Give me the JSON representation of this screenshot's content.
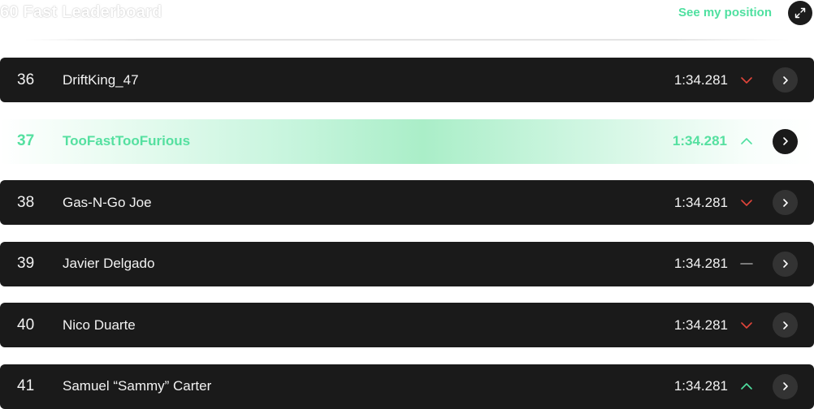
{
  "header": {
    "title": "60 Fast Leaderboard",
    "see_position_label": "See my position"
  },
  "colors": {
    "accent": "#4fe0a0",
    "down": "#e0453a",
    "up": "#4fe0a0",
    "neutral": "#9a9a9a",
    "row_bg": "#1a1a1a"
  },
  "rows": [
    {
      "rank": "36",
      "driver": "DriftKing_47",
      "time": "1:34.281",
      "trend": "down",
      "trend_icon": "chevron-down-icon"
    },
    {
      "rank": "37",
      "driver": "TooFastTooFurious",
      "time": "1:34.281",
      "trend": "up",
      "trend_icon": "chevron-up-icon",
      "current_user": true
    },
    {
      "rank": "38",
      "driver": "Gas-N-Go Joe",
      "time": "1:34.281",
      "trend": "down",
      "trend_icon": "chevron-down-icon"
    },
    {
      "rank": "39",
      "driver": "Javier Delgado",
      "time": "1:34.281",
      "trend": "same",
      "trend_icon": "dash-icon"
    },
    {
      "rank": "40",
      "driver": "Nico Duarte",
      "time": "1:34.281",
      "trend": "down",
      "trend_icon": "chevron-down-icon"
    },
    {
      "rank": "41",
      "driver": "Samuel “Sammy” Carter",
      "time": "1:34.281",
      "trend": "up",
      "trend_icon": "chevron-up-icon"
    }
  ]
}
